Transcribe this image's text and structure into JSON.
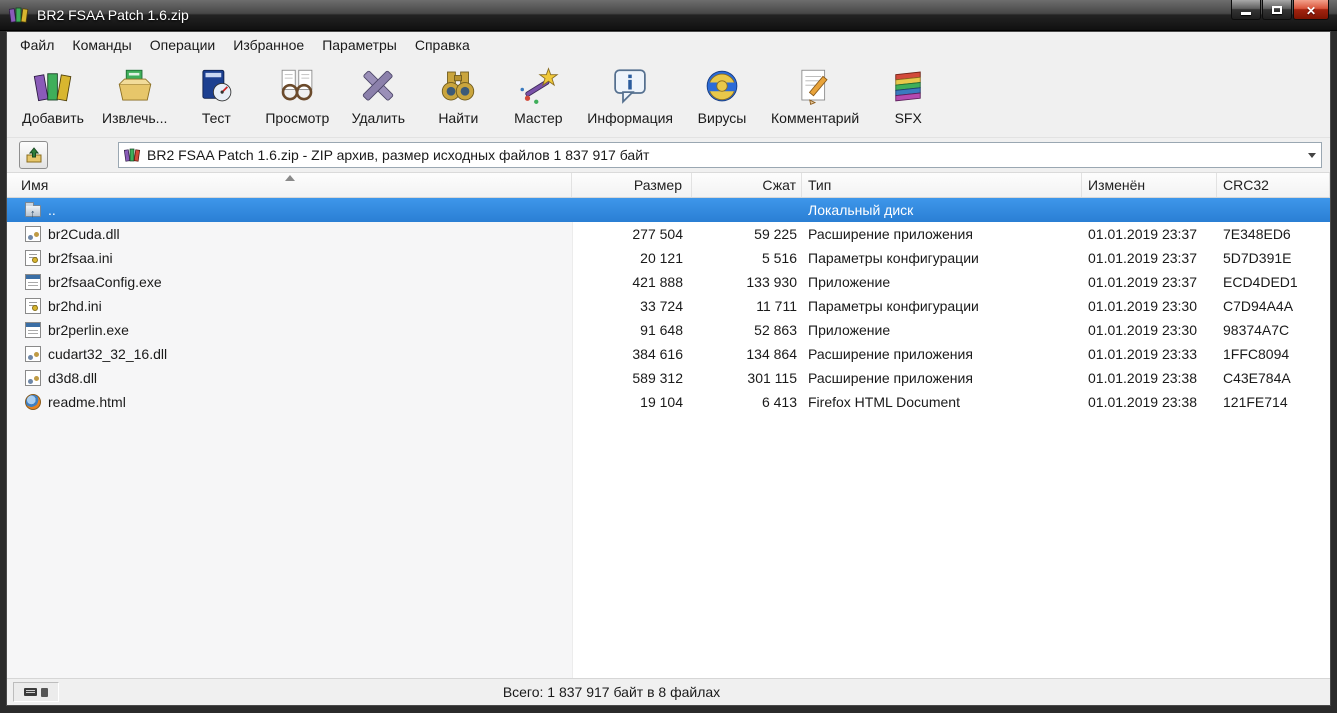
{
  "window": {
    "title": "BR2 FSAA Patch 1.6.zip",
    "controls": [
      "minimize",
      "maximize",
      "close"
    ]
  },
  "menu": {
    "items": [
      {
        "label": "Файл"
      },
      {
        "label": "Команды"
      },
      {
        "label": "Операции"
      },
      {
        "label": "Избранное"
      },
      {
        "label": "Параметры"
      },
      {
        "label": "Справка"
      }
    ]
  },
  "toolbar": {
    "buttons": [
      {
        "label": "Добавить",
        "icon": "add"
      },
      {
        "label": "Извлечь...",
        "icon": "extract"
      },
      {
        "label": "Тест",
        "icon": "test"
      },
      {
        "label": "Просмотр",
        "icon": "view"
      },
      {
        "label": "Удалить",
        "icon": "delete"
      },
      {
        "label": "Найти",
        "icon": "find"
      },
      {
        "label": "Мастер",
        "icon": "wizard"
      },
      {
        "label": "Информация",
        "icon": "info"
      },
      {
        "label": "Вирусы",
        "icon": "virus"
      },
      {
        "label": "Комментарий",
        "icon": "comment"
      },
      {
        "label": "SFX",
        "icon": "sfx"
      }
    ]
  },
  "addressbar": {
    "value": "BR2 FSAA Patch 1.6.zip - ZIP архив, размер исходных файлов 1 837 917 байт"
  },
  "list": {
    "columns": [
      "Имя",
      "Размер",
      "Сжат",
      "Тип",
      "Изменён",
      "CRC32"
    ],
    "sort": {
      "column": "Имя",
      "direction": "ascending"
    },
    "rows": [
      {
        "name": "..",
        "size": "",
        "packed": "",
        "type": "Локальный диск",
        "modified": "",
        "crc": "",
        "icon": "folder-up",
        "selected": true
      },
      {
        "name": "br2Cuda.dll",
        "size": "277 504",
        "packed": "59 225",
        "type": "Расширение приложения",
        "modified": "01.01.2019 23:37",
        "crc": "7E348ED6",
        "icon": "dll",
        "selected": false
      },
      {
        "name": "br2fsaa.ini",
        "size": "20 121",
        "packed": "5 516",
        "type": "Параметры конфигурации",
        "modified": "01.01.2019 23:37",
        "crc": "5D7D391E",
        "icon": "ini",
        "selected": false
      },
      {
        "name": "br2fsaaConfig.exe",
        "size": "421 888",
        "packed": "133 930",
        "type": "Приложение",
        "modified": "01.01.2019 23:37",
        "crc": "ECD4DED1",
        "icon": "exe",
        "selected": false
      },
      {
        "name": "br2hd.ini",
        "size": "33 724",
        "packed": "11 711",
        "type": "Параметры конфигурации",
        "modified": "01.01.2019 23:30",
        "crc": "C7D94A4A",
        "icon": "ini",
        "selected": false
      },
      {
        "name": "br2perlin.exe",
        "size": "91 648",
        "packed": "52 863",
        "type": "Приложение",
        "modified": "01.01.2019 23:30",
        "crc": "98374A7C",
        "icon": "exe",
        "selected": false
      },
      {
        "name": "cudart32_32_16.dll",
        "size": "384 616",
        "packed": "134 864",
        "type": "Расширение приложения",
        "modified": "01.01.2019 23:33",
        "crc": "1FFC8094",
        "icon": "dll",
        "selected": false
      },
      {
        "name": "d3d8.dll",
        "size": "589 312",
        "packed": "301 115",
        "type": "Расширение приложения",
        "modified": "01.01.2019 23:38",
        "crc": "C43E784A",
        "icon": "dll",
        "selected": false
      },
      {
        "name": "readme.html",
        "size": "19 104",
        "packed": "6 413",
        "type": "Firefox HTML Document",
        "modified": "01.01.2019 23:38",
        "crc": "121FE714",
        "icon": "html",
        "selected": false
      }
    ]
  },
  "statusbar": {
    "total": "Всего: 1 837 917 байт в 8 файлах"
  }
}
